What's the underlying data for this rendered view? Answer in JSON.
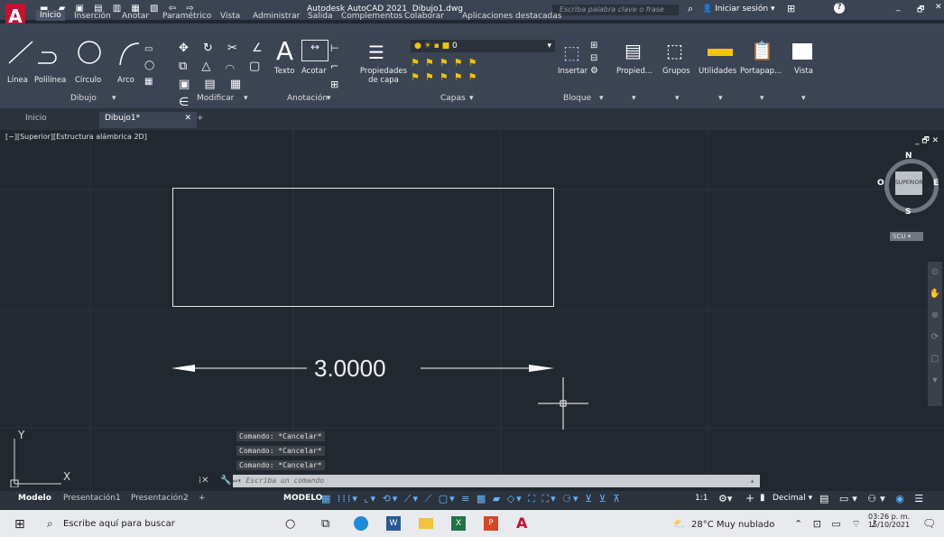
{
  "app": {
    "title": "Autodesk AutoCAD 2021",
    "file": "Dibujo1.dwg",
    "search_placeholder": "Escriba palabra clave o frase",
    "login": "Iniciar sesión"
  },
  "ribbon_tabs": [
    "Inicio",
    "Inserción",
    "Anotar",
    "Paramétrico",
    "Vista",
    "Administrar",
    "Salida",
    "Complementos",
    "Colaborar",
    "Aplicaciones destacadas"
  ],
  "draw_panel": {
    "buttons": [
      "Línea",
      "Polilínea",
      "Círculo",
      "Arco"
    ],
    "title": "Dibujo"
  },
  "modify_panel": {
    "title": "Modificar"
  },
  "annotation_panel": {
    "buttons": [
      "Texto",
      "Acotar"
    ],
    "title": "Anotación"
  },
  "layers_panel": {
    "button": "Propiedades de capa",
    "layer_value": "0",
    "title": "Capas"
  },
  "block_panel": {
    "button": "Insertar",
    "title": "Bloque"
  },
  "extra_buttons": [
    "Propied...",
    "Grupos",
    "Utilidades",
    "Portapap...",
    "Vista"
  ],
  "doc_tabs": [
    "Inicio",
    "Dibujo1*"
  ],
  "viewport_label": "[−][Superior][Estructura alámbrica 2D]",
  "viewcube": {
    "top": "SUPERIOR",
    "n": "N",
    "s": "S",
    "e": "E",
    "w": "O",
    "ucs": "SCU"
  },
  "dimension": "3.0000",
  "command_history": [
    "Comando: *Cancelar*",
    "Comando: *Cancelar*",
    "Comando: *Cancelar*"
  ],
  "command_placeholder": "Escriba un comando",
  "layout_tabs": [
    "Modelo",
    "Presentación1",
    "Presentación2"
  ],
  "status": {
    "model": "MODELO",
    "scale": "1:1",
    "units": "Decimal"
  },
  "taskbar": {
    "search": "Escribe aquí para buscar",
    "weather": "28°C  Muy nublado",
    "time": "03:26 p. m.",
    "date": "15/10/2021"
  }
}
